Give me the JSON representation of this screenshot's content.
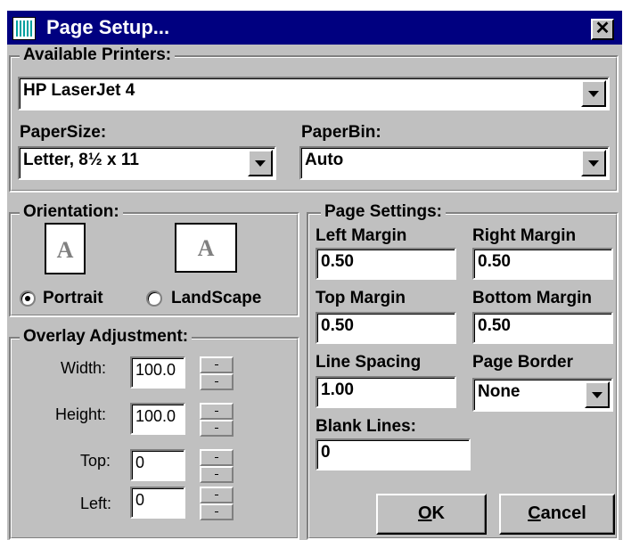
{
  "window": {
    "title": "Page Setup...",
    "close_label": "✕"
  },
  "printers": {
    "legend": "Available Printers:",
    "selected": "HP LaserJet 4",
    "paper_size_label": "PaperSize:",
    "paper_size_value": "Letter, 8½ x 11",
    "paper_bin_label": "PaperBin:",
    "paper_bin_value": "Auto"
  },
  "orientation": {
    "legend": "Orientation:",
    "icon_letter": "A",
    "portrait_label": "Portrait",
    "landscape_label": "LandScape",
    "selected": "Portrait"
  },
  "overlay": {
    "legend": "Overlay Adjustment:",
    "width_label": "Width:",
    "width_value": "100.0",
    "height_label": "Height:",
    "height_value": "100.0",
    "top_label": "Top:",
    "top_value": "0",
    "left_label": "Left:",
    "left_value": "0"
  },
  "page_settings": {
    "legend": "Page Settings:",
    "left_margin_label": "Left Margin",
    "left_margin_value": "0.50",
    "right_margin_label": "Right Margin",
    "right_margin_value": "0.50",
    "top_margin_label": "Top Margin",
    "top_margin_value": "0.50",
    "bottom_margin_label": "Bottom Margin",
    "bottom_margin_value": "0.50",
    "line_spacing_label": "Line Spacing",
    "line_spacing_value": "1.00",
    "page_border_label": "Page Border",
    "page_border_value": "None",
    "blank_lines_label": "Blank Lines:",
    "blank_lines_value": "0"
  },
  "buttons": {
    "ok_hotkey": "O",
    "ok_rest": "K",
    "cancel_hotkey": "C",
    "cancel_rest": "ancel"
  }
}
